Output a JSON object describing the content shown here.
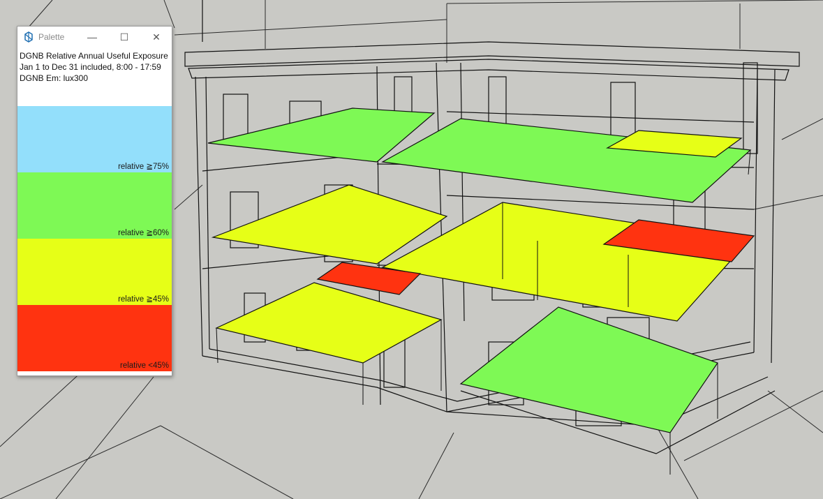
{
  "window": {
    "title": "Palette",
    "controls": {
      "minimize": "—",
      "maximize": "☐",
      "close": "✕"
    }
  },
  "info": {
    "line1": "DGNB Relative Annual Useful Exposure",
    "line2": "Jan 1 to Dec 31 included, 8:00 - 17:59",
    "line3": "DGNB Em: lux300"
  },
  "legend": [
    {
      "label": "relative ≧75%",
      "color": "#93dffb"
    },
    {
      "label": "relative ≧60%",
      "color": "#7ef955"
    },
    {
      "label": "relative ≧45%",
      "color": "#e6ff17"
    },
    {
      "label": "relative <45%",
      "color": "#ff3310"
    }
  ],
  "colors": {
    "background": "#c9c9c5",
    "edge": "#111111"
  }
}
